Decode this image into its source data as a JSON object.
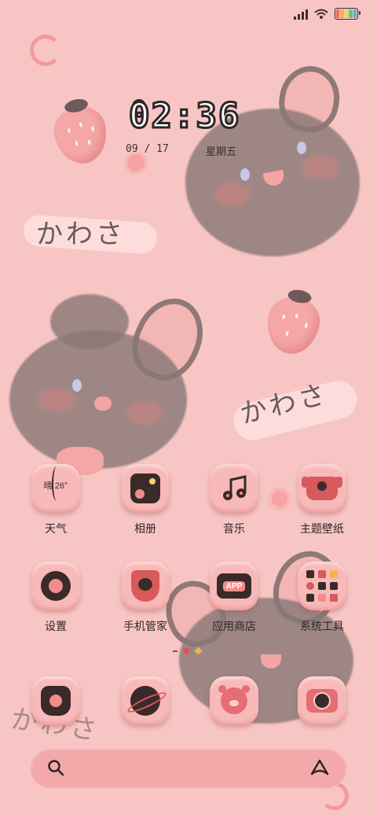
{
  "status_bar": {
    "signal_icon": "cell-signal-icon",
    "wifi_icon": "wifi-icon",
    "battery_icon": "battery-icon",
    "battery_colors": [
      "#f06a6a",
      "#f5b14d",
      "#f2d94a",
      "#6fc36f",
      "#6aa6e8"
    ]
  },
  "clock": {
    "time": "02:36",
    "date": "09 / 17",
    "weekday": "星期五"
  },
  "wallpaper": {
    "decor_text": [
      "かわさ",
      "かわさ",
      "かわさ"
    ]
  },
  "apps": [
    {
      "name": "天气",
      "icon": "weather-icon",
      "badge": "晴 26°"
    },
    {
      "name": "相册",
      "icon": "gallery-icon"
    },
    {
      "name": "音乐",
      "icon": "music-icon"
    },
    {
      "name": "主题壁纸",
      "icon": "theme-icon"
    },
    {
      "name": "设置",
      "icon": "settings-icon"
    },
    {
      "name": "手机管家",
      "icon": "phone-manager-icon"
    },
    {
      "name": "应用商店",
      "icon": "app-store-icon",
      "badge": "APP"
    },
    {
      "name": "系统工具",
      "icon": "system-tools-icon"
    }
  ],
  "dock": [
    {
      "icon": "phone-icon"
    },
    {
      "icon": "browser-planet-icon"
    },
    {
      "icon": "messages-bear-icon"
    },
    {
      "icon": "camera-icon"
    }
  ],
  "search_bar": {
    "search_icon": "search-icon",
    "assistant_icon": "assistant-icon"
  }
}
